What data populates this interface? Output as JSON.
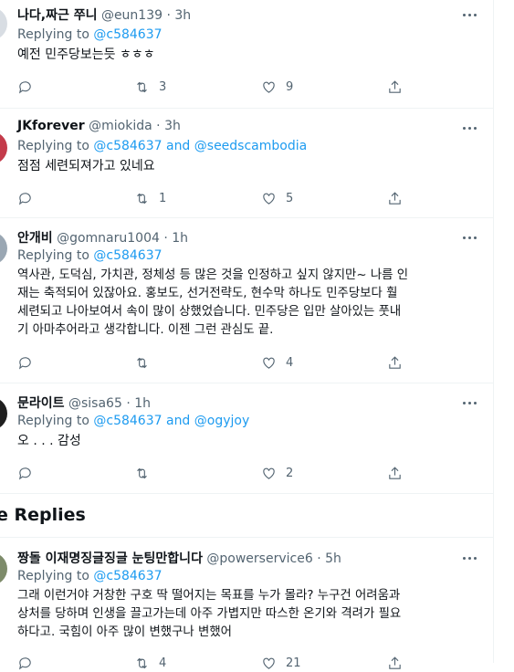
{
  "tweets": [
    {
      "name": "나다,짜근 쭈니",
      "handle": "@eun139",
      "time": "· 3h",
      "replying_label": "Replying to",
      "replying_to": "@c584637",
      "replying_extra": "",
      "text": [
        "예전 민주당보는듯 ㅎㅎㅎ"
      ],
      "retweets": "3",
      "likes": "9",
      "replies": "",
      "avatar_color": "#d8dde3"
    },
    {
      "name": "JKforever",
      "handle": "@miokida",
      "time": "· 3h",
      "replying_label": "Replying to",
      "replying_to": "@c584637",
      "replying_extra": "and @seedscambodia",
      "text": [
        "점점 세련되져가고 있네요"
      ],
      "retweets": "1",
      "likes": "5",
      "replies": "",
      "avatar_color": "#c43b4b"
    },
    {
      "name": "안개비",
      "handle": "@gomnaru1004",
      "time": "· 1h",
      "replying_label": "Replying to",
      "replying_to": "@c584637",
      "replying_extra": "",
      "text": [
        "역사관, 도덕심, 가치관, 정체성 등 많은 것을 인정하고 싶지 않지만~ 나름 인",
        "재는 축적되어 있잖아요. 홍보도, 선거전략도, 현수막 하나도 민주당보다 훨",
        "세련되고 나아보여서 속이 많이 상했었습니다. 민주당은 입만 살아있는 풋내",
        "기 아마추어라고 생각합니다. 이젠 그런 관심도 끝."
      ],
      "retweets": "",
      "likes": "4",
      "replies": "",
      "avatar_color": "#9aa7b3"
    },
    {
      "name": "문라이트",
      "handle": "@sisa65",
      "time": "· 1h",
      "replying_label": "Replying to",
      "replying_to": "@c584637",
      "replying_extra": "and @ogyjoy",
      "text": [
        "오 . . . 감성"
      ],
      "retweets": "",
      "likes": "2",
      "replies": "",
      "avatar_color": "#1f1f1f"
    },
    {
      "name": "짱돌 이재명징글징글 눈팅만합니다",
      "handle": "@powerservice6",
      "time": "· 5h",
      "replying_label": "Replying to",
      "replying_to": "@c584637",
      "replying_extra": "",
      "text": [
        "그래 이런거야 거창한 구호 딱 떨어지는 목표를 누가 몰라? 누구건 어려움과",
        "상처를 당하며 인생을 끌고가는데 아주 가볍지만 따스한 온기와 격려가 필요",
        "하다고. 국힘이 아주 많이 변했구나 변했어"
      ],
      "retweets": "4",
      "likes": "21",
      "replies": "",
      "avatar_color": "#7d8b6a"
    }
  ],
  "section_title": "e Replies",
  "icons": [
    "reply-icon",
    "retweet-icon",
    "like-icon",
    "share-icon",
    "more-icon"
  ],
  "colors": {
    "link": "#1d9bf0",
    "muted": "#536471",
    "text": "#0f1419"
  }
}
